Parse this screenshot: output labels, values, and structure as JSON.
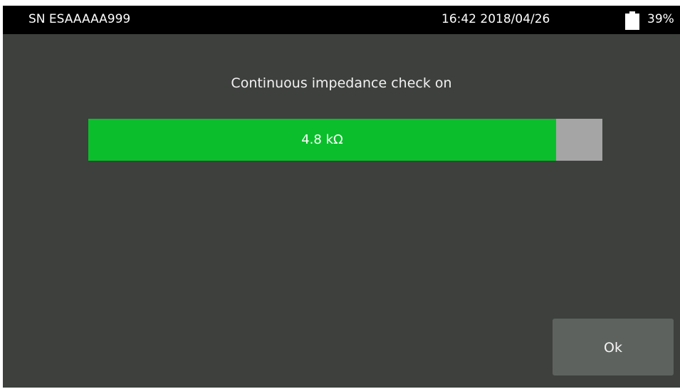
{
  "statusbar": {
    "serial": "SN ESAAAAA999",
    "datetime": "16:42 2018/04/26",
    "battery_icon": "battery-icon",
    "battery_percent": "39%",
    "battery_level": 0.39
  },
  "main": {
    "message": "Continuous impedance check on",
    "impedance_value": "4.8 kΩ",
    "impedance_fill_fraction": 0.91,
    "colors": {
      "fill": "#0abf2b",
      "remainder": "#a5a5a5",
      "background": "#3d403d"
    }
  },
  "buttons": {
    "ok_label": "Ok"
  }
}
